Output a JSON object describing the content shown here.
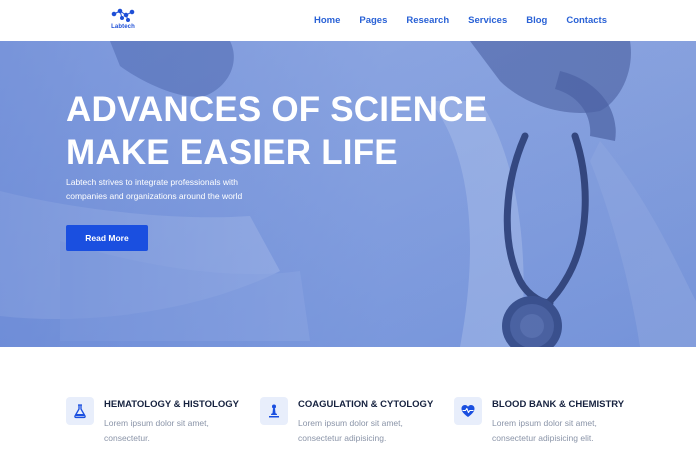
{
  "brand": {
    "name": "Labtech"
  },
  "nav": {
    "items": [
      "Home",
      "Pages",
      "Research",
      "Services",
      "Blog",
      "Contacts"
    ]
  },
  "hero": {
    "title_line1": "ADVANCES OF SCIENCE",
    "title_line2": "MAKE EASIER LIFE",
    "subtitle_line1": "Labtech strives to integrate professionals with",
    "subtitle_line2": "companies and organizations around the world",
    "cta_label": "Read More"
  },
  "features": [
    {
      "icon": "flask-icon",
      "title": "HEMATOLOGY & HISTOLOGY",
      "line1": "Lorem ipsum dolor sit amet,",
      "line2": "consectetur."
    },
    {
      "icon": "microscope-icon",
      "title": "COAGULATION & CYTOLOGY",
      "line1": "Lorem ipsum dolor sit amet,",
      "line2": "consectetur adipisicing."
    },
    {
      "icon": "heartbeat-icon",
      "title": "BLOOD BANK & CHEMISTRY",
      "line1": "Lorem ipsum dolor sit amet,",
      "line2": "consectetur adipisicing elit."
    }
  ],
  "colors": {
    "accent": "#1a4fe0",
    "nav": "#2a62d6",
    "hero_tint": "#6f8fd8"
  }
}
